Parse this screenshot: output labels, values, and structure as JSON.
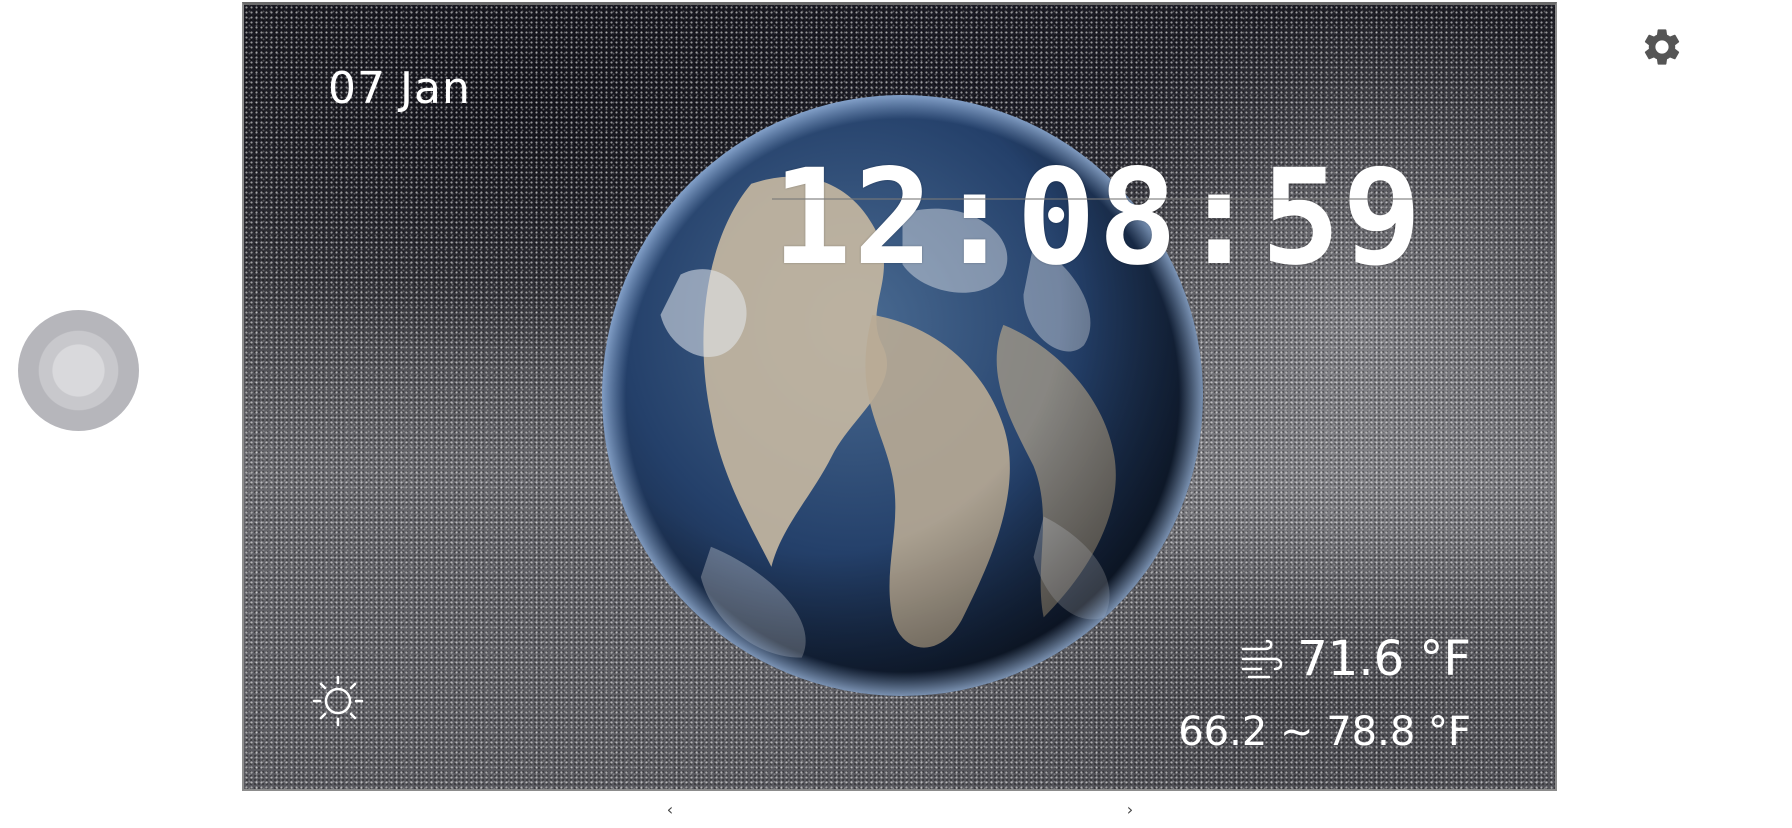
{
  "date": {
    "day": "07",
    "month": "Jan"
  },
  "clock": {
    "time": "12:08:59"
  },
  "weather": {
    "current_temp": "71.6 °F",
    "range": "66.2 ~ 78.8 °F"
  },
  "icons": {
    "settings": "gear-icon",
    "brightness": "sun-icon",
    "wind": "wind-icon",
    "floating": "assistive-touch-icon",
    "nav_prev": "chevron-left-icon",
    "nav_next": "chevron-right-icon"
  },
  "nav": {
    "prev_glyph": "‹",
    "next_glyph": "›"
  },
  "colors": {
    "text": "#ffffff",
    "gear": "#555555"
  }
}
